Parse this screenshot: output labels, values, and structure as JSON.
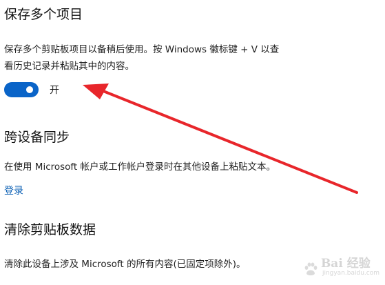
{
  "sections": {
    "history": {
      "title": "保存多个项目",
      "description_line1": "保存多个剪贴板项目以备稍后使用。按 Windows 徽标键 + V 以查",
      "description_line2": "看历史记录并粘贴其中的内容。",
      "toggle_state": "开",
      "toggle_on": true
    },
    "sync": {
      "title": "跨设备同步",
      "description": "在使用 Microsoft 帐户或工作帐户登录时在其他设备上粘贴文本。",
      "link_label": "登录"
    },
    "clear": {
      "title": "清除剪贴板数据",
      "description": "清除此设备上涉及 Microsoft 的所有内容(已固定项除外)。"
    }
  },
  "annotation": {
    "arrow_color": "#e8262b"
  },
  "watermark": {
    "main": "Bai 经验",
    "sub": "jingyan.baidu.com"
  },
  "colors": {
    "accent": "#0a64c8",
    "link": "#0a5fb4"
  }
}
